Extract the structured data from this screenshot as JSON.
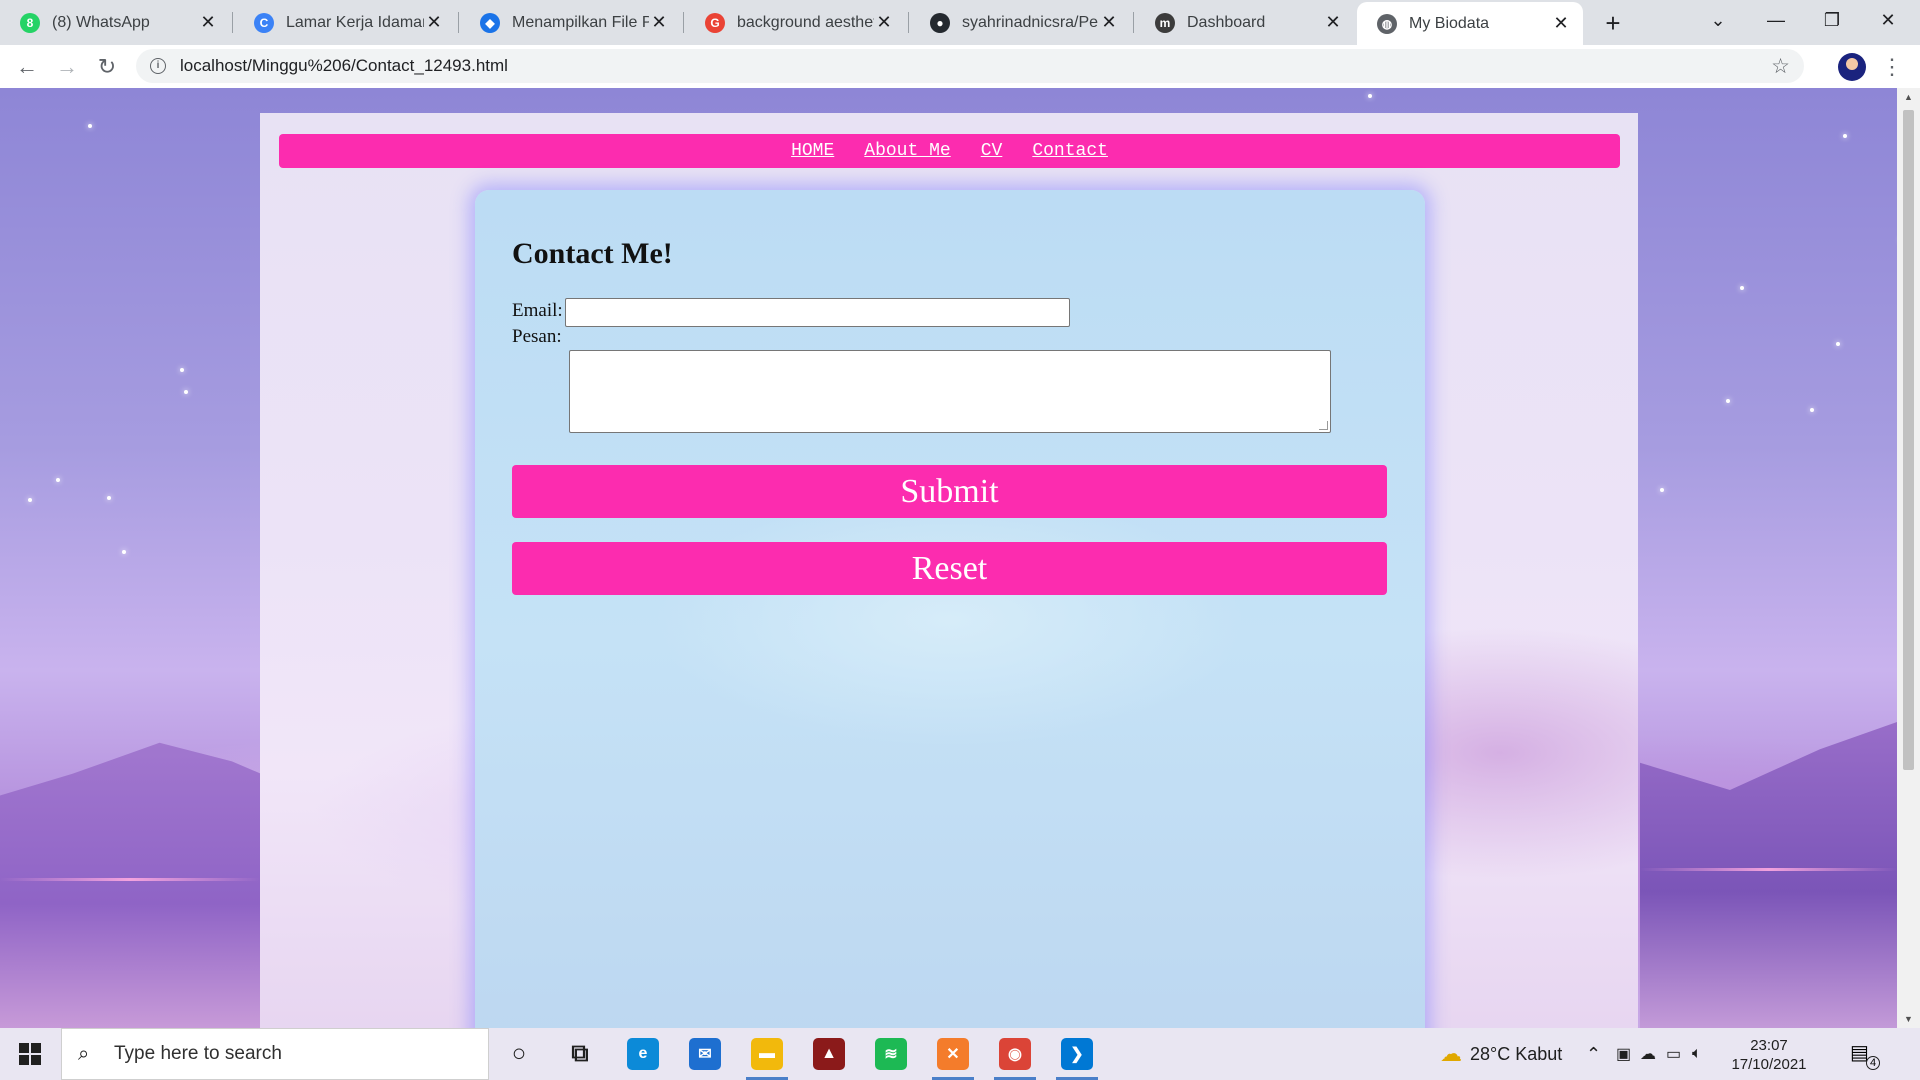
{
  "browser": {
    "tabs": [
      {
        "title": "(8) WhatsApp",
        "icon": "whatsapp-icon",
        "color": "#25d366",
        "glyph": "8"
      },
      {
        "title": "Lamar Kerja Idaman di",
        "icon": "glints-icon",
        "color": "#3b82f6",
        "glyph": "C"
      },
      {
        "title": "Menampilkan File PDF",
        "icon": "code-diamond-icon",
        "color": "#1a73e8",
        "glyph": "◆"
      },
      {
        "title": "background aesthetic",
        "icon": "google-icon",
        "color": "#ea4335",
        "glyph": "G"
      },
      {
        "title": "syahrinadnicsra/Pem-",
        "icon": "github-icon",
        "color": "#24292f",
        "glyph": "●"
      },
      {
        "title": "Dashboard",
        "icon": "moodle-icon",
        "color": "#3c3c3c",
        "glyph": "m"
      },
      {
        "title": "My Biodata",
        "icon": "globe-icon",
        "color": "#5f6368",
        "glyph": "◍",
        "active": true
      }
    ],
    "new_tab_label": "+",
    "url": "localhost/Minggu%206/Contact_12493.html"
  },
  "page": {
    "nav": [
      {
        "label": "HOME"
      },
      {
        "label": "About Me"
      },
      {
        "label": "CV"
      },
      {
        "label": "Contact"
      }
    ],
    "form": {
      "title": "Contact Me!",
      "email_label": "Email:",
      "email_value": "",
      "message_label": "Pesan:",
      "message_value": "",
      "submit_label": "Submit",
      "reset_label": "Reset"
    },
    "colors": {
      "accent": "#fc2caf",
      "card": "#bcdcf4"
    }
  },
  "taskbar": {
    "search_placeholder": "Type here to search",
    "apps": [
      {
        "name": "cortana-icon",
        "glyph": "○"
      },
      {
        "name": "task-view-icon",
        "glyph": "⧉"
      },
      {
        "name": "edge-icon",
        "glyph": "e",
        "color": "#0c8ad8"
      },
      {
        "name": "mail-icon",
        "glyph": "✉",
        "color": "#1e6fd0"
      },
      {
        "name": "file-explorer-icon",
        "glyph": "▬",
        "color": "#f2b90c",
        "open": true
      },
      {
        "name": "game-app-icon",
        "glyph": "▲",
        "color": "#8b1a1a"
      },
      {
        "name": "spotify-icon",
        "glyph": "≋",
        "color": "#1db954"
      },
      {
        "name": "xampp-icon",
        "glyph": "✕",
        "color": "#f47c2b",
        "open": true
      },
      {
        "name": "chrome-icon",
        "glyph": "◉",
        "color": "#db4437",
        "open": true
      },
      {
        "name": "vscode-icon",
        "glyph": "❯",
        "color": "#0078d4",
        "open": true
      }
    ],
    "weather": "28°C  Kabut",
    "time": "23:07",
    "date": "17/10/2021",
    "notifications": "4"
  }
}
